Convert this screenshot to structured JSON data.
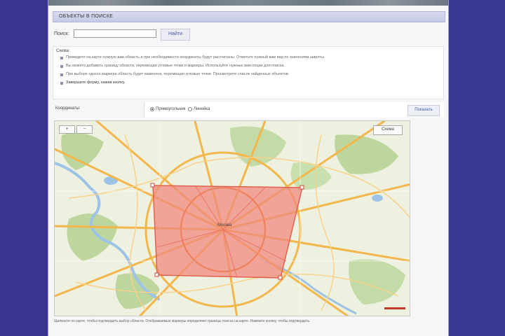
{
  "section": {
    "title": "объекты в поиске"
  },
  "search": {
    "label": "Поиск:",
    "value": "",
    "button": "Найти"
  },
  "help": {
    "title": "Схема:",
    "items": [
      "Приведите на карте нужную вам область и при необходимости координаты будут рассчитаны. Отметьте нужный вам вид по значениям широты.",
      "Вы можете добавить границу области, перемещая угловые точки и маркеры. Используйте нужные вам опции для поиска.",
      "При выборе одного маркера область будет изменена, перемещая угловые точки. Просмотрите список найденных объектов.",
      "Завершите форму, нажав кнопку."
    ]
  },
  "controls": {
    "coords_label": "Координаты:",
    "radio_1": "Прямоугольник",
    "radio_2": "Линейка",
    "apply_button": "Показать"
  },
  "map": {
    "zoom_in": "+",
    "zoom_out": "−",
    "type_button": "Схема",
    "city_label": "Москва",
    "polygon_color": "#f08a7e",
    "road_color": "#f3b64b",
    "park_color": "#b8d49a",
    "water_color": "#9cc3e6"
  },
  "footer": {
    "note": "Щелкните по карте, чтобы подтвердить выбор области. Отображаемые маркеры определяют границы поиска на карте. Нажмите кнопку, чтобы подтвердить."
  },
  "colors": {
    "background": "#3a3592",
    "header": "#c6c9e6"
  }
}
